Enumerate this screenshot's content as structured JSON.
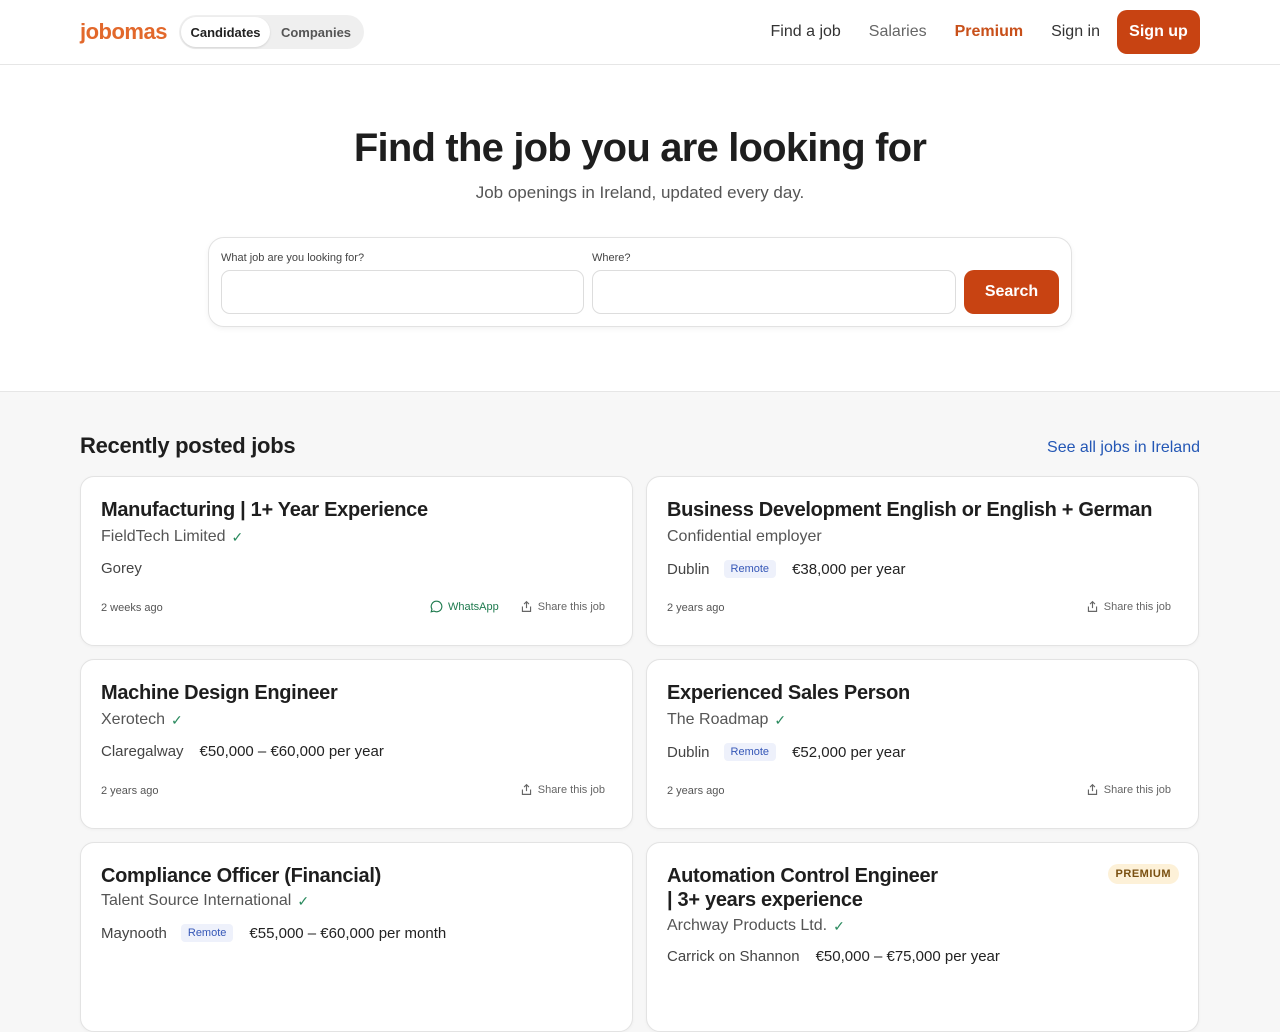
{
  "header": {
    "logo": "jobomas",
    "toggle": {
      "candidates": "Candidates",
      "companies": "Companies"
    },
    "nav": {
      "find_job": "Find a job",
      "salaries": "Salaries",
      "premium": "Premium",
      "sign_in": "Sign in",
      "sign_up": "Sign up"
    }
  },
  "hero": {
    "title": "Find the job you are looking for",
    "subtitle": "Job openings in Ireland, updated every day.",
    "what_label": "What job are you looking for?",
    "where_label": "Where?",
    "what_value": "",
    "where_value": "",
    "search_label": "Search"
  },
  "recent": {
    "title": "Recently posted jobs",
    "see_all": "See all jobs in Ireland",
    "jobs": [
      {
        "title": "Manufacturing | 1+ Year Experience",
        "company": "FieldTech Limited",
        "verified": "✓",
        "location": "Gorey",
        "tag": "",
        "salary": "",
        "ago": "2 weeks ago",
        "whatsapp": "WhatsApp",
        "share": "Share this job",
        "badge": ""
      },
      {
        "title": "Business Development English or English + German",
        "company": "Confidential employer",
        "verified": "",
        "location": "Dublin",
        "tag": "Remote",
        "salary": "€38,000 per year",
        "ago": "2 years ago",
        "whatsapp": "",
        "share": "Share this job",
        "badge": ""
      },
      {
        "title": "Machine Design Engineer",
        "company": "Xerotech",
        "verified": "✓",
        "location": "Claregalway",
        "tag": "",
        "salary": "€50,000 – €60,000 per year",
        "ago": "2 years ago",
        "whatsapp": "",
        "share": "Share this job",
        "badge": ""
      },
      {
        "title": "Experienced Sales Person",
        "company": "The Roadmap",
        "verified": "✓",
        "location": "Dublin",
        "tag": "Remote",
        "salary": "€52,000 per year",
        "ago": "2 years ago",
        "whatsapp": "",
        "share": "Share this job",
        "badge": ""
      },
      {
        "title": "Compliance Officer (Financial)",
        "company": "Talent Source International",
        "verified": "✓",
        "location": "Maynooth",
        "tag": "Remote",
        "salary": "€55,000 – €60,000 per month",
        "ago": "",
        "whatsapp": "",
        "share": "",
        "badge": ""
      },
      {
        "title_line1": "Automation Control Engineer",
        "title_line2": "| 3+ years experience",
        "company": "Archway Products Ltd.",
        "verified": "✓",
        "location": "Carrick on Shannon",
        "tag": "",
        "salary": "€50,000 – €75,000 per year",
        "ago": "",
        "whatsapp": "",
        "share": "",
        "badge": "PREMIUM"
      }
    ]
  }
}
